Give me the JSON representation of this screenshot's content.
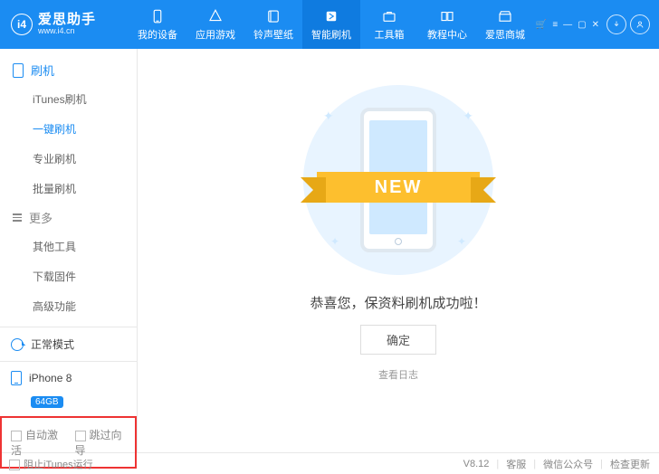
{
  "header": {
    "logo_letters": "i4",
    "app_name_cn": "爱思助手",
    "app_url": "www.i4.cn",
    "nav": [
      {
        "label": "我的设备"
      },
      {
        "label": "应用游戏"
      },
      {
        "label": "铃声壁纸"
      },
      {
        "label": "智能刷机"
      },
      {
        "label": "工具箱"
      },
      {
        "label": "教程中心"
      },
      {
        "label": "爱思商城"
      }
    ]
  },
  "sidebar": {
    "group1_title": "刷机",
    "group1": [
      {
        "label": "iTunes刷机"
      },
      {
        "label": "一键刷机"
      },
      {
        "label": "专业刷机"
      },
      {
        "label": "批量刷机"
      }
    ],
    "group2_title": "更多",
    "group2": [
      {
        "label": "其他工具"
      },
      {
        "label": "下载固件"
      },
      {
        "label": "高级功能"
      }
    ],
    "mode_label": "正常模式",
    "device_name": "iPhone 8",
    "device_badge": "64GB",
    "check_auto_activate": "自动激活",
    "check_skip_guide": "跳过向导"
  },
  "main": {
    "ribbon_text": "NEW",
    "success_msg": "恭喜您，保资料刷机成功啦！",
    "ok_btn": "确定",
    "view_log": "查看日志"
  },
  "footer": {
    "block_itunes": "阻止iTunes运行",
    "version": "V8.12",
    "support": "客服",
    "wechat": "微信公众号",
    "update": "检查更新"
  }
}
